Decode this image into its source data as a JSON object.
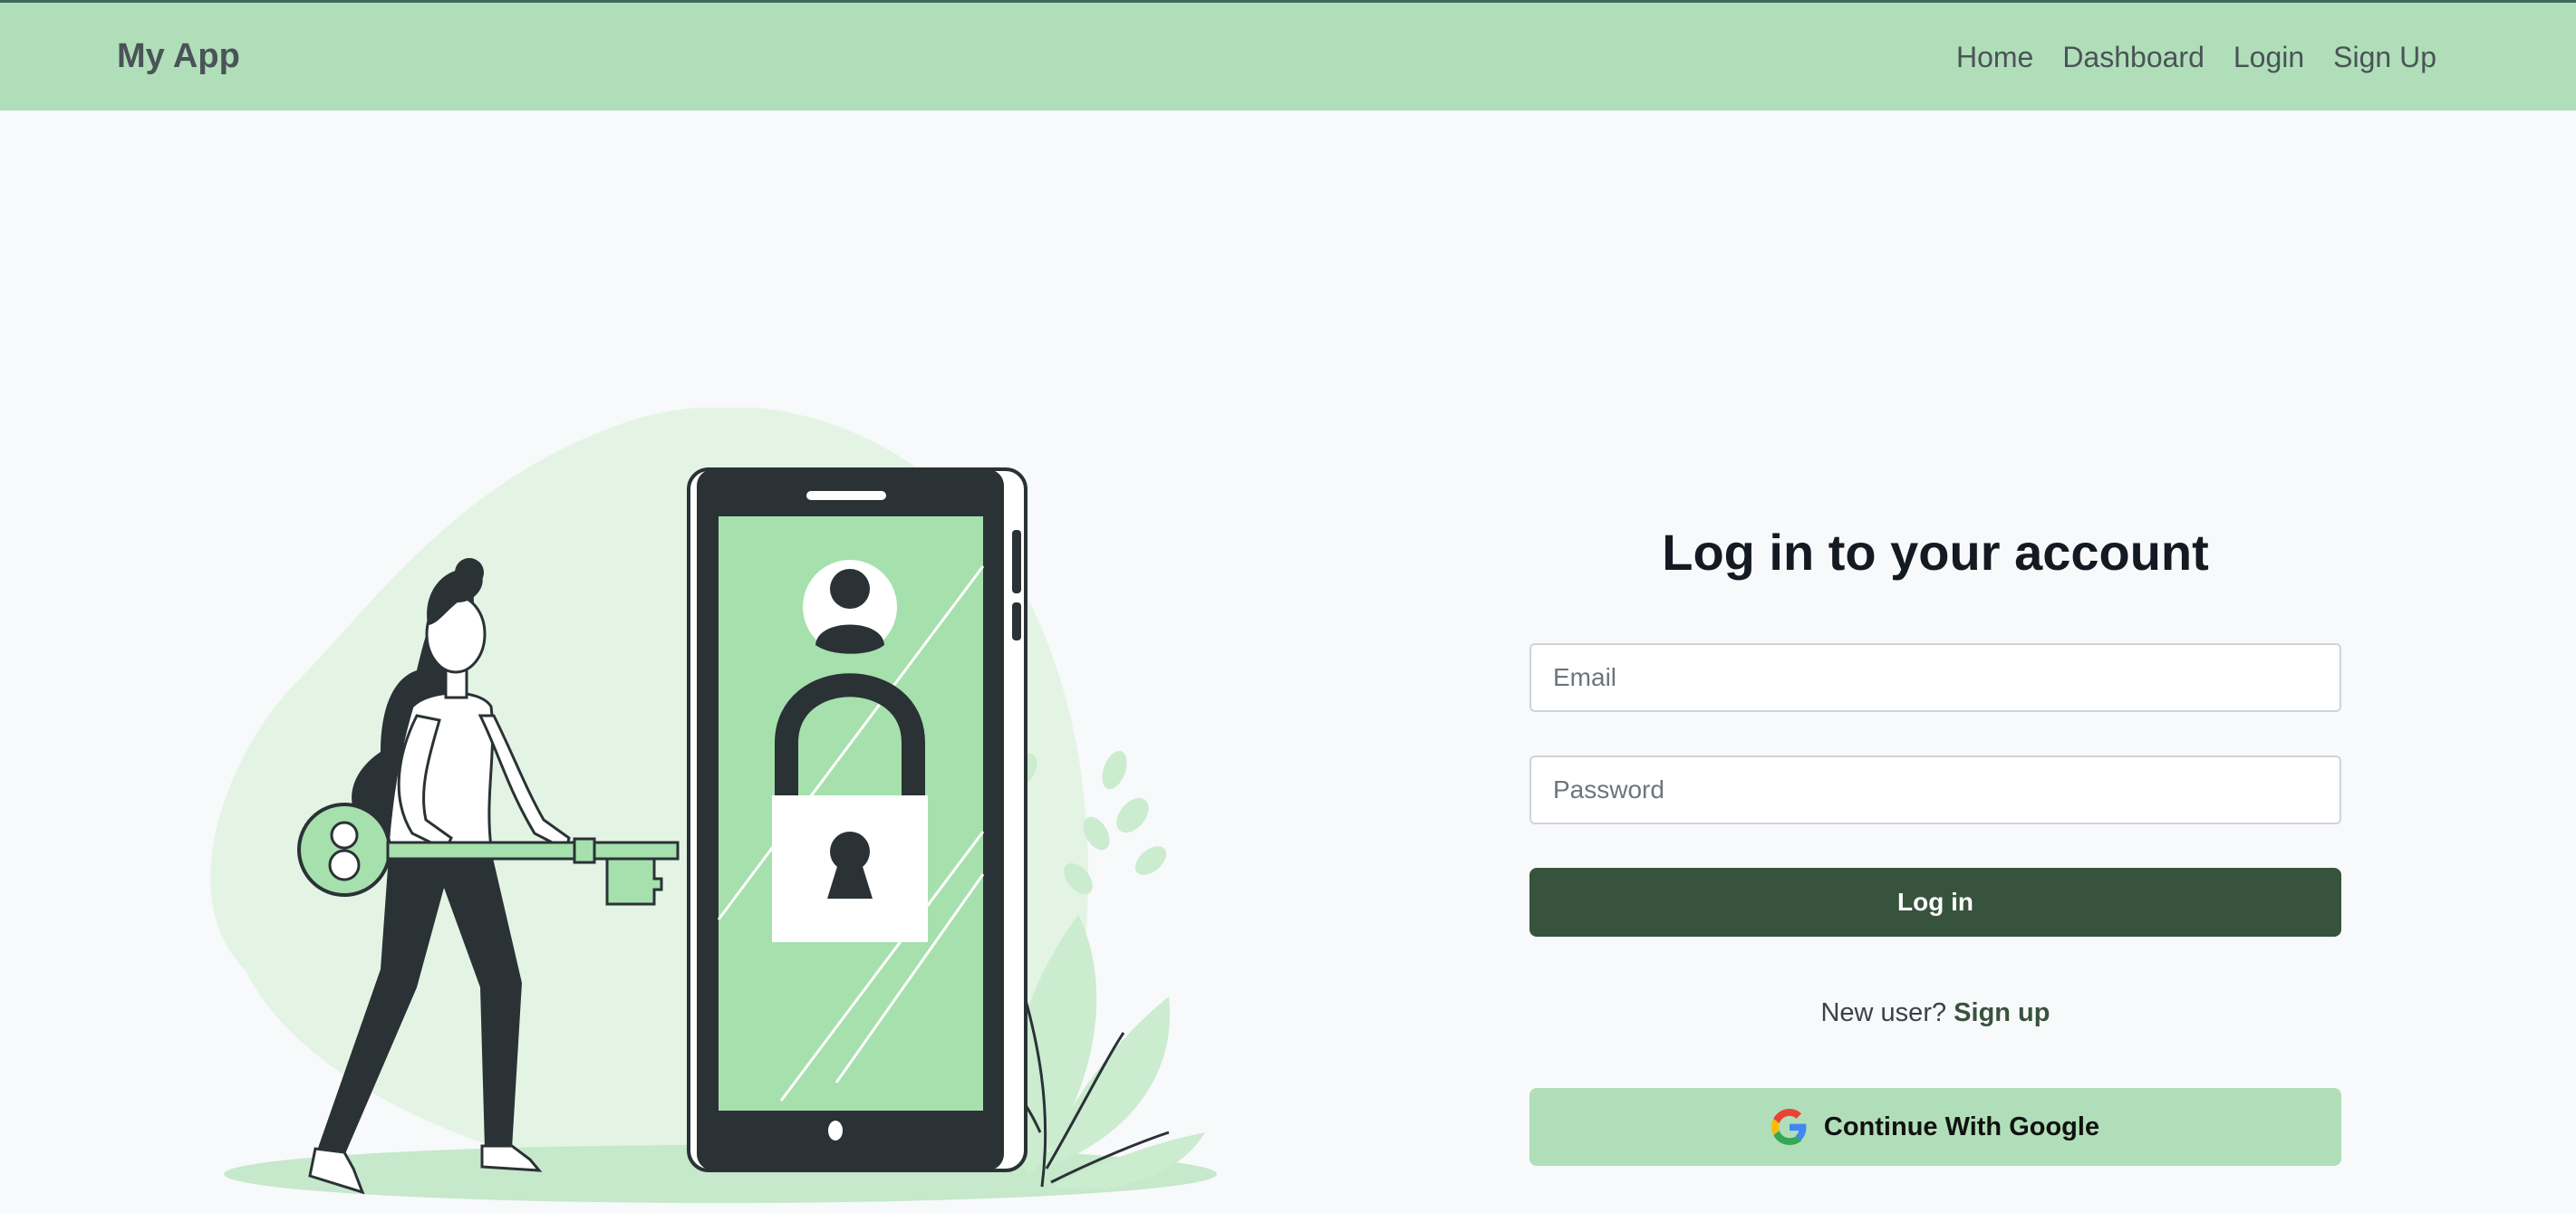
{
  "navbar": {
    "brand": "My App",
    "links": [
      "Home",
      "Dashboard",
      "Login",
      "Sign Up"
    ]
  },
  "login": {
    "title": "Log in to your account",
    "email_placeholder": "Email",
    "password_placeholder": "Password",
    "submit_label": "Log in",
    "new_user_text": "New user?",
    "signup_link": "Sign up",
    "google_label": "Continue With Google"
  },
  "icons": {
    "google": "google-g-icon",
    "avatar": "user-avatar-icon",
    "lock": "padlock-icon"
  },
  "colors": {
    "navbar_bg": "#b0deb8",
    "primary_button": "#38533c",
    "google_button": "#b0deb8",
    "page_bg": "#f8f9fb",
    "illustration_green": "#a6e0ad"
  }
}
